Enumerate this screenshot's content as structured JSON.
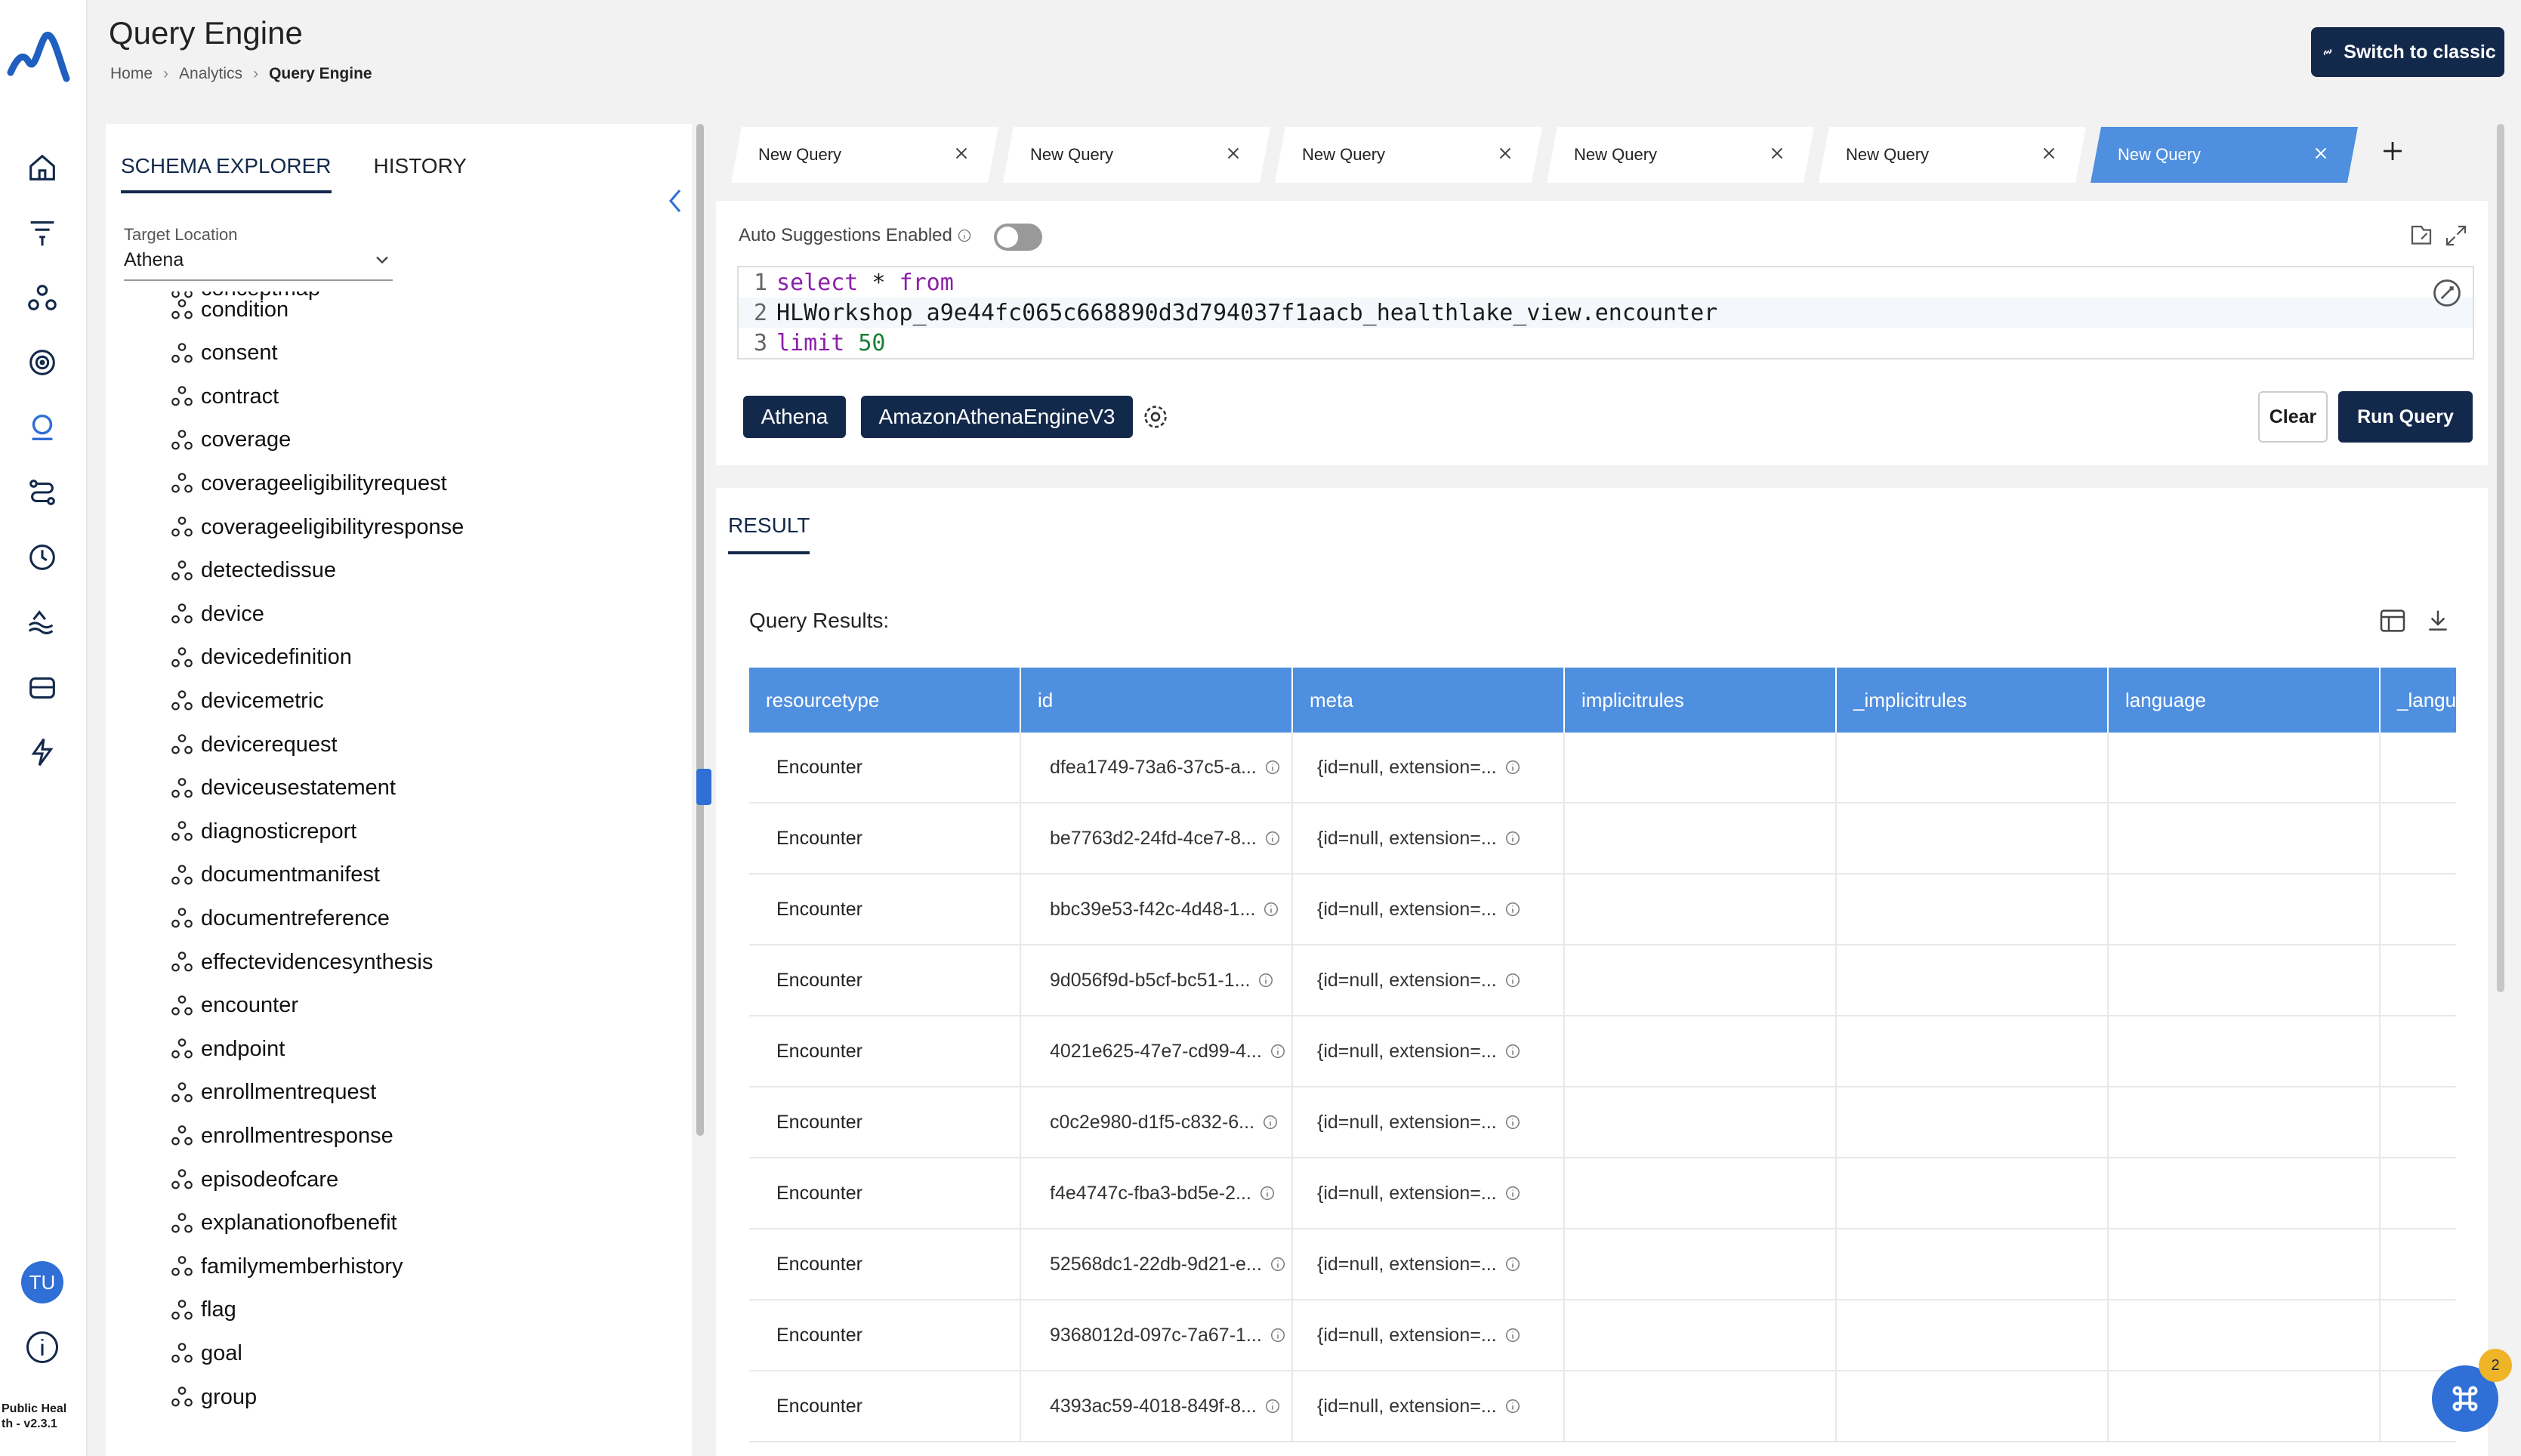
{
  "app": {
    "title": "Query Engine",
    "version": "Public Health - v2.3.1",
    "version_line1": "Public Heal",
    "version_line2": "th - v2.3.1",
    "user_initials": "TU"
  },
  "breadcrumb": [
    "Home",
    "Analytics",
    "Query Engine"
  ],
  "header": {
    "switch_label": "Switch to classic"
  },
  "schema": {
    "tabs": [
      "SCHEMA EXPLORER",
      "HISTORY"
    ],
    "target_label": "Target Location",
    "target_value": "Athena",
    "cut_item": "conceptmap",
    "items": [
      "condition",
      "consent",
      "contract",
      "coverage",
      "coverageeligibilityrequest",
      "coverageeligibilityresponse",
      "detectedissue",
      "device",
      "devicedefinition",
      "devicemetric",
      "devicerequest",
      "deviceusestatement",
      "diagnosticreport",
      "documentmanifest",
      "documentreference",
      "effectevidencesynthesis",
      "encounter",
      "endpoint",
      "enrollmentrequest",
      "enrollmentresponse",
      "episodeofcare",
      "explanationofbenefit",
      "familymemberhistory",
      "flag",
      "goal",
      "group"
    ]
  },
  "query_tabs": [
    "New Query",
    "New Query",
    "New Query",
    "New Query",
    "New Query",
    "New Query"
  ],
  "editor": {
    "auto_suggestions_label": "Auto Suggestions Enabled",
    "line_numbers": [
      "1",
      "2",
      "3"
    ],
    "line1_select": "select",
    "line1_star": " * ",
    "line1_from": "from",
    "line2": "HLWorkshop_a9e44fc065c668890d3d794037f1aacb_healthlake_view.encounter",
    "line3_limit": "limit",
    "line3_num": "50",
    "engine": "Athena",
    "engine_version": "AmazonAthenaEngineV3",
    "clear_label": "Clear",
    "run_label": "Run Query"
  },
  "results": {
    "tab_label": "RESULT",
    "title": "Query Results:",
    "columns": [
      "resourcetype",
      "id",
      "meta",
      "implicitrules",
      "_implicitrules",
      "language",
      "_langua"
    ],
    "rows": [
      {
        "resourcetype": "Encounter",
        "id": "dfea1749-73a6-37c5-a...",
        "meta": "{id=null, extension=..."
      },
      {
        "resourcetype": "Encounter",
        "id": "be7763d2-24fd-4ce7-8...",
        "meta": "{id=null, extension=..."
      },
      {
        "resourcetype": "Encounter",
        "id": "bbc39e53-f42c-4d48-1...",
        "meta": "{id=null, extension=..."
      },
      {
        "resourcetype": "Encounter",
        "id": "9d056f9d-b5cf-bc51-1...",
        "meta": "{id=null, extension=..."
      },
      {
        "resourcetype": "Encounter",
        "id": "4021e625-47e7-cd99-4...",
        "meta": "{id=null, extension=..."
      },
      {
        "resourcetype": "Encounter",
        "id": "c0c2e980-d1f5-c832-6...",
        "meta": "{id=null, extension=..."
      },
      {
        "resourcetype": "Encounter",
        "id": "f4e4747c-fba3-bd5e-2...",
        "meta": "{id=null, extension=..."
      },
      {
        "resourcetype": "Encounter",
        "id": "52568dc1-22db-9d21-e...",
        "meta": "{id=null, extension=..."
      },
      {
        "resourcetype": "Encounter",
        "id": "9368012d-097c-7a67-1...",
        "meta": "{id=null, extension=..."
      },
      {
        "resourcetype": "Encounter",
        "id": "4393ac59-4018-849f-8...",
        "meta": "{id=null, extension=..."
      }
    ]
  },
  "help": {
    "badge_count": "2"
  },
  "colors": {
    "navy": "#13294b",
    "accent": "#4f8fe0",
    "blue": "#2f6fd6"
  }
}
